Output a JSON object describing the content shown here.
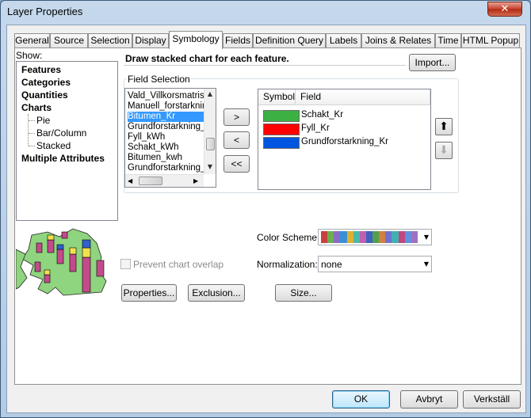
{
  "window": {
    "title": "Layer Properties",
    "close_glyph": "✕"
  },
  "tabs": [
    {
      "label": "General"
    },
    {
      "label": "Source"
    },
    {
      "label": "Selection"
    },
    {
      "label": "Display"
    },
    {
      "label": "Symbology",
      "active": true
    },
    {
      "label": "Fields"
    },
    {
      "label": "Definition Query"
    },
    {
      "label": "Labels"
    },
    {
      "label": "Joins & Relates"
    },
    {
      "label": "Time"
    },
    {
      "label": "HTML Popup"
    }
  ],
  "show": {
    "label": "Show:",
    "items": [
      "Features",
      "Categories",
      "Quantities",
      "Charts",
      "Pie",
      "Bar/Column",
      "Stacked",
      "Multiple Attributes"
    ]
  },
  "description": "Draw stacked chart for each feature.",
  "import_button": "Import...",
  "field_selection": {
    "label": "Field Selection",
    "available": [
      "Vald_Villkorsmatris",
      "Manuell_forstarkning",
      "Bitumen_Kr",
      "Grundforstarkning_k",
      "Fyll_kWh",
      "Schakt_kWh",
      "Bitumen_kwh",
      "Grundforstarkning_C"
    ],
    "selected_index": 2,
    "move_buttons": [
      ">",
      "<",
      "<<"
    ],
    "table_headers": {
      "symbol": "Symbol",
      "field": "Field"
    },
    "chosen": [
      {
        "field": "Schakt_Kr",
        "color": "#3cb043"
      },
      {
        "field": "Fyll_Kr",
        "color": "#ff0000"
      },
      {
        "field": "Grundforstarkning_Kr",
        "color": "#0055e0"
      }
    ]
  },
  "color_scheme": {
    "label": "Color  Scheme:",
    "colors": [
      "#c84040",
      "#6ab04c",
      "#8a6cc8",
      "#3a8fd6",
      "#e0b030",
      "#4cb8a8",
      "#c060b0",
      "#4060c0",
      "#50a050",
      "#d08040",
      "#7070d0",
      "#40b0b0",
      "#c04880",
      "#6090e0",
      "#a070c0"
    ]
  },
  "normalization": {
    "label": "Normalization:",
    "value": "none"
  },
  "prevent_overlap": {
    "label": "Prevent chart overlap",
    "checked": false
  },
  "buttons": {
    "properties": "Properties...",
    "exclusion": "Exclusion...",
    "size": "Size...",
    "ok": "OK",
    "cancel": "Avbryt",
    "apply": "Verkställ"
  },
  "icons": {
    "up": "up-arrow-icon",
    "down": "down-arrow-icon",
    "preview": "stacked-chart-map-preview"
  },
  "colors": {
    "accent": "#3399ff",
    "map_fill": "#8fd47e"
  }
}
